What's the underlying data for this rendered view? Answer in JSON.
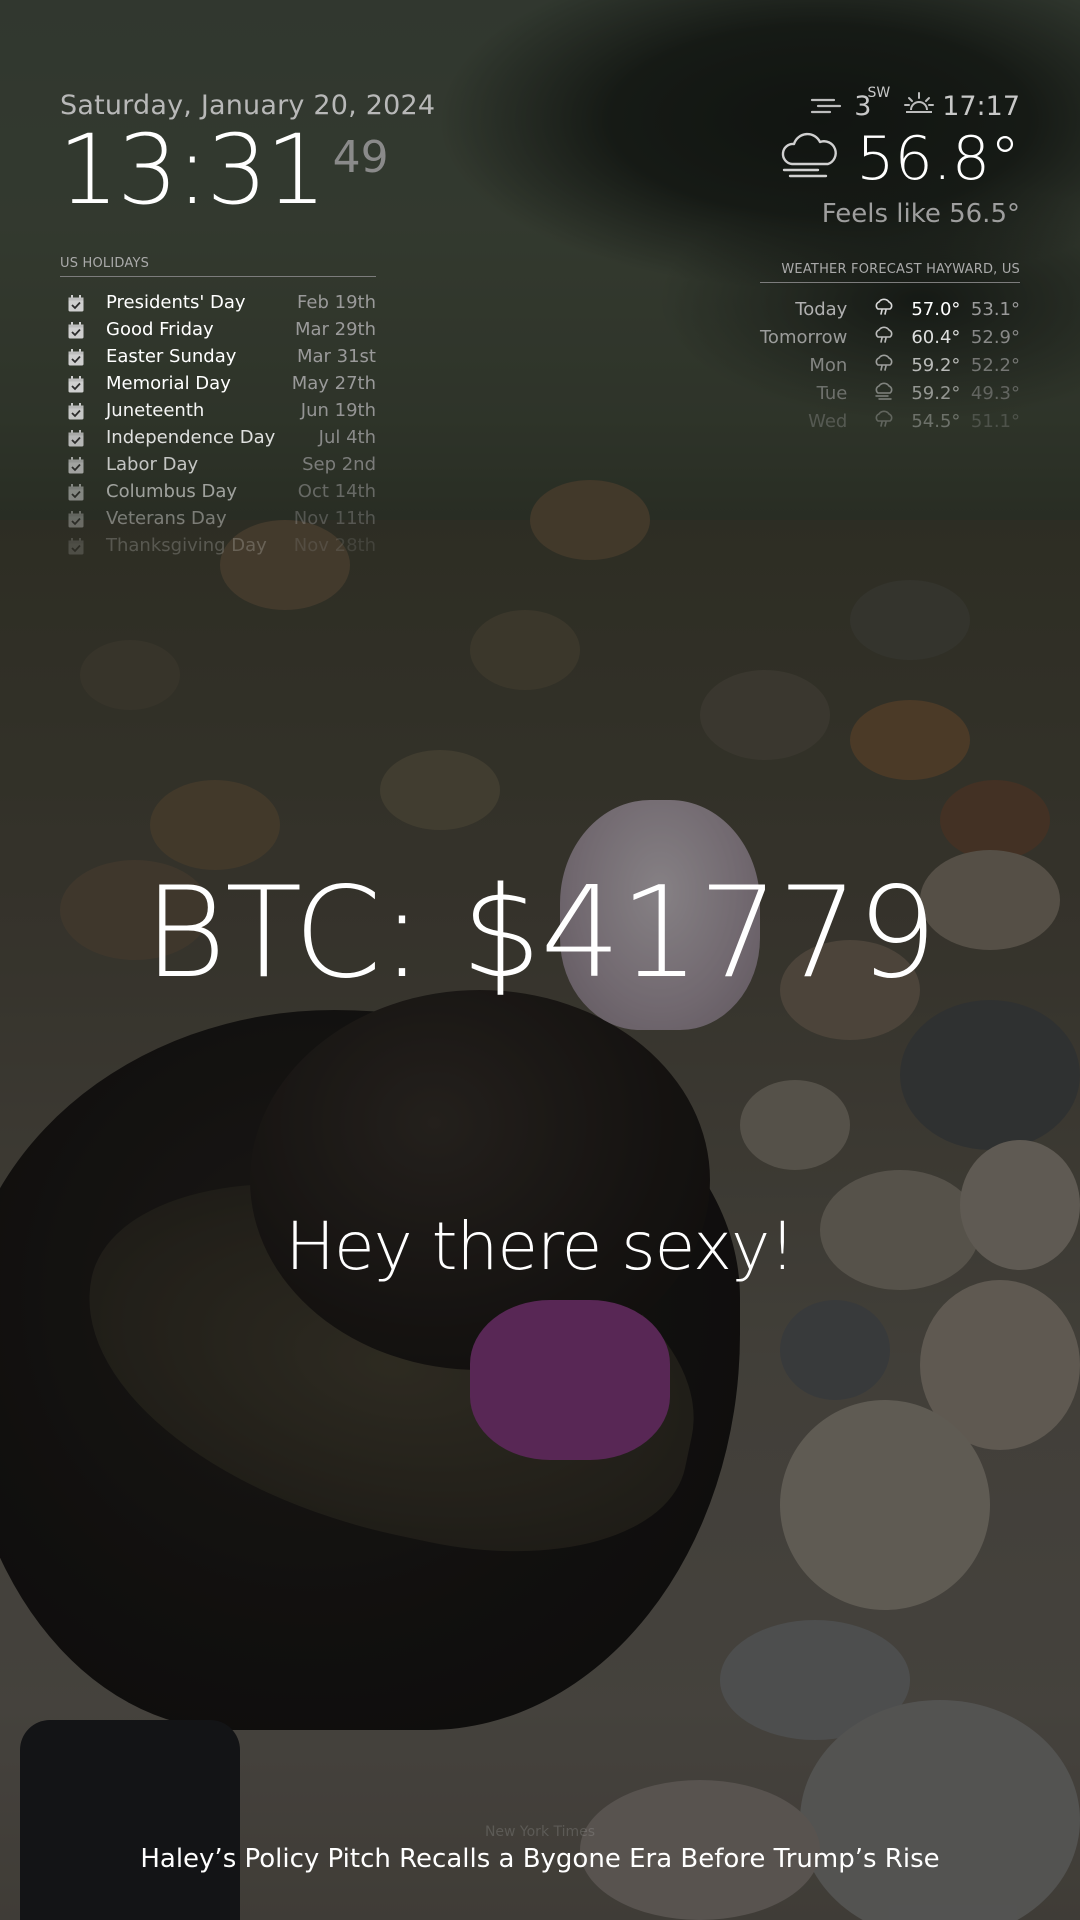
{
  "clock": {
    "date": "Saturday, January 20, 2024",
    "time": "13:31",
    "seconds": "49"
  },
  "calendar": {
    "header": "US HOLIDAYS",
    "events": [
      {
        "title": "Presidents' Day",
        "date": "Feb 19th",
        "opacity": 1.0
      },
      {
        "title": "Good Friday",
        "date": "Mar 29th",
        "opacity": 1.0
      },
      {
        "title": "Easter Sunday",
        "date": "Mar 31st",
        "opacity": 1.0
      },
      {
        "title": "Memorial Day",
        "date": "May 27th",
        "opacity": 1.0
      },
      {
        "title": "Juneteenth",
        "date": "Jun 19th",
        "opacity": 0.95
      },
      {
        "title": "Independence Day",
        "date": "Jul 4th",
        "opacity": 0.85
      },
      {
        "title": "Labor Day",
        "date": "Sep 2nd",
        "opacity": 0.72
      },
      {
        "title": "Columbus Day",
        "date": "Oct 14th",
        "opacity": 0.55
      },
      {
        "title": "Veterans Day",
        "date": "Nov 11th",
        "opacity": 0.38
      },
      {
        "title": "Thanksgiving Day",
        "date": "Nov 28th",
        "opacity": 0.2
      }
    ]
  },
  "weather": {
    "wind_speed": "3",
    "wind_direction": "SW",
    "sunset_time": "17:17",
    "temperature": "56.8°",
    "feels_like": "Feels like 56.5°",
    "icons": {
      "wind": "wind-icon",
      "sunset": "sunset-icon",
      "condition": "cloudy-rain-icon"
    }
  },
  "forecast": {
    "header": "WEATHER FORECAST HAYWARD, US",
    "days": [
      {
        "day": "Today",
        "max": "57.0°",
        "min": "53.1°",
        "icon": "rain-icon",
        "opacity": 1.0
      },
      {
        "day": "Tomorrow",
        "max": "60.4°",
        "min": "52.9°",
        "icon": "rain-icon",
        "opacity": 0.85
      },
      {
        "day": "Mon",
        "max": "59.2°",
        "min": "52.2°",
        "icon": "rain-icon",
        "opacity": 0.68
      },
      {
        "day": "Tue",
        "max": "59.2°",
        "min": "49.3°",
        "icon": "cloudy-icon",
        "opacity": 0.5
      },
      {
        "day": "Wed",
        "max": "54.5°",
        "min": "51.1°",
        "icon": "rain-icon",
        "opacity": 0.3
      }
    ]
  },
  "btc": {
    "text": "BTC: $41779"
  },
  "compliment": {
    "text": "Hey there sexy!"
  },
  "news": {
    "source": "New York Times",
    "headline": "Haley’s Policy Pitch Recalls a Bygone Era Before Trump’s Rise"
  }
}
